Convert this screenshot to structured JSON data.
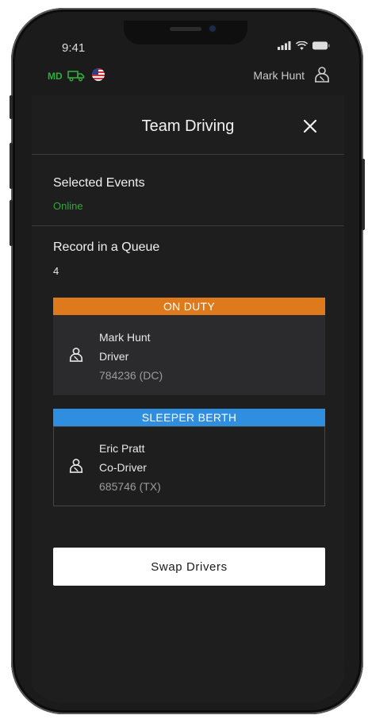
{
  "status_bar": {
    "time": "9:41"
  },
  "app_header": {
    "state_code": "MD",
    "user_name": "Mark Hunt"
  },
  "dialog": {
    "title": "Team Driving",
    "selected_events": {
      "label": "Selected Events",
      "value": "Online"
    },
    "record_queue": {
      "label": "Record in a Queue",
      "value": "4"
    },
    "cards": [
      {
        "status": "ON DUTY",
        "status_color": "#df7a1c",
        "body_color": "#2b2b2d",
        "name": "Mark Hunt",
        "role": "Driver",
        "license": "784236 (DC)"
      },
      {
        "status": "SLEEPER BERTH",
        "status_color": "#2f8ee0",
        "body_color": "#1e1e1f",
        "name": "Eric Pratt",
        "role": "Co-Driver",
        "license": "685746 (TX)"
      }
    ],
    "swap_button": "Swap Drivers"
  },
  "icons": {
    "signal": "signal-icon",
    "wifi": "wifi-icon",
    "battery": "battery-icon",
    "truck": "truck-icon",
    "flag": "us-flag-icon",
    "user": "user-icon",
    "close": "close-icon"
  },
  "colors": {
    "accent_green": "#35a43f",
    "on_duty": "#df7a1c",
    "sleeper_berth": "#2f8ee0",
    "surface": "#1e1e1f",
    "card_active": "#2b2b2d"
  }
}
